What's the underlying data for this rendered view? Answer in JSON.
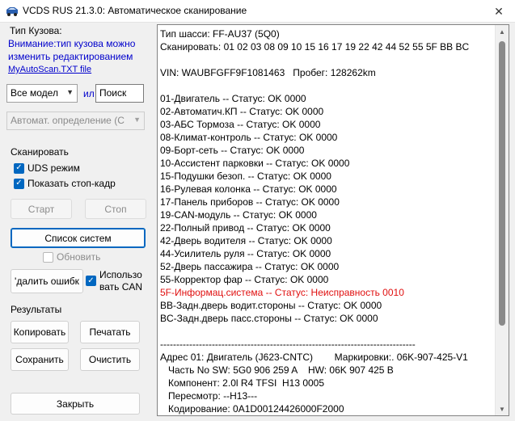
{
  "window": {
    "title": "VCDS RUS 21.3.0:  Автоматическое сканирование",
    "close_glyph": "✕"
  },
  "left": {
    "body_type_label": "Тип Кузова:",
    "warning_line1": "Внимание:тип кузова можно",
    "warning_line2": "изменить редактированием",
    "file_link": "MyAutoScan.TXT file",
    "model_combo": "Все модел",
    "or_label": "ил",
    "search_value": "Поиск",
    "auto_detect_combo": "Автомат. определение (С",
    "scan_label": "Сканировать",
    "uds_mode": "UDS режим",
    "show_freeze": "Показать стоп-кадр",
    "start_button": "Старт",
    "stop_button": "Стоп",
    "system_list_button": "Список систем",
    "refresh": "Обновить",
    "clear_errors_button": "'далить ошибк",
    "use_can_line1": "Использо",
    "use_can_line2": "вать CAN",
    "results_label": "Результаты",
    "copy_button": "Копировать",
    "print_button": "Печатать",
    "save_button": "Сохранить",
    "clear_button": "Очистить",
    "close_button": "Закрыть"
  },
  "output": {
    "lines": [
      {
        "text": "Тип шасси: FF-AU37 (5Q0)",
        "error": false
      },
      {
        "text": "Сканировать: 01 02 03 08 09 10 15 16 17 19 22 42 44 52 55 5F BB BC",
        "error": false
      },
      {
        "text": "",
        "error": false
      },
      {
        "text": "VIN: WAUBFGFF9F1081463   Пробег: 128262km",
        "error": false
      },
      {
        "text": "",
        "error": false
      },
      {
        "text": "01-Двигатель -- Статус: OK 0000",
        "error": false
      },
      {
        "text": "02-Автоматич.КП -- Статус: OK 0000",
        "error": false
      },
      {
        "text": "03-АБС Тормоза -- Статус: OK 0000",
        "error": false
      },
      {
        "text": "08-Климат-контроль -- Статус: OK 0000",
        "error": false
      },
      {
        "text": "09-Борт-сеть -- Статус: OK 0000",
        "error": false
      },
      {
        "text": "10-Ассистент парковки -- Статус: OK 0000",
        "error": false
      },
      {
        "text": "15-Подушки безоп. -- Статус: OK 0000",
        "error": false
      },
      {
        "text": "16-Рулевая колонка -- Статус: OK 0000",
        "error": false
      },
      {
        "text": "17-Панель приборов -- Статус: OK 0000",
        "error": false
      },
      {
        "text": "19-CAN-модуль -- Статус: OK 0000",
        "error": false
      },
      {
        "text": "22-Полный привод -- Статус: OK 0000",
        "error": false
      },
      {
        "text": "42-Дверь водителя -- Статус: OK 0000",
        "error": false
      },
      {
        "text": "44-Усилитель руля -- Статус: OK 0000",
        "error": false
      },
      {
        "text": "52-Дверь пассажира -- Статус: OK 0000",
        "error": false
      },
      {
        "text": "55-Корректор фар -- Статус: OK 0000",
        "error": false
      },
      {
        "text": "5F-Информац.система -- Статус: Неисправность 0010",
        "error": true
      },
      {
        "text": "BB-Задн.дверь водит.стороны -- Статус: OK 0000",
        "error": false
      },
      {
        "text": "BC-Задн.дверь пасс.стороны -- Статус: OK 0000",
        "error": false
      },
      {
        "text": "",
        "error": false
      },
      {
        "text": "-------------------------------------------------------------------------------",
        "error": false
      },
      {
        "text": "Адрес 01: Двигатель (J623-CNTC)        Маркировки:. 06K-907-425-V1",
        "error": false
      },
      {
        "text": "   Часть No SW: 5G0 906 259 A    HW: 06K 907 425 B",
        "error": false
      },
      {
        "text": "   Компонент: 2.0l R4 TFSI  H13 0005",
        "error": false
      },
      {
        "text": "   Пересмотр: --H13---",
        "error": false
      },
      {
        "text": "   Кодирование: 0A1D00124426000F2000",
        "error": false
      }
    ]
  },
  "colors": {
    "accent": "#0067c0",
    "error_text": "#e01010",
    "link": "#0000cc"
  }
}
